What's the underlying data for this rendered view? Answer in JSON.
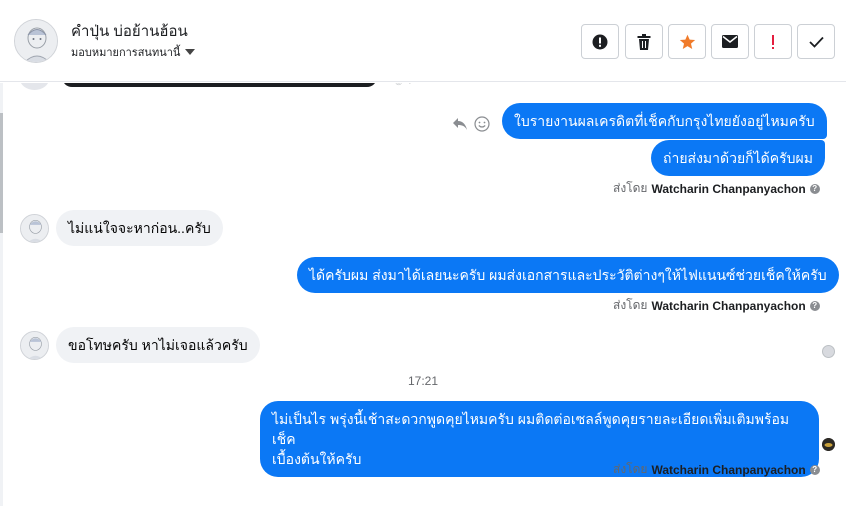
{
  "header": {
    "contact_name": "คำปุ่น บ่อย้านฮ้อน",
    "assign_label": "มอบหมายการสนทนานี้"
  },
  "toolbar": {
    "buttons": [
      "alert-circle-icon",
      "trash-icon",
      "star-icon",
      "mail-icon",
      "exclamation-icon",
      "check-icon"
    ]
  },
  "messages": {
    "m1": "ใบรายงานผลเครดิตที่เช็คกับกรุงไทยยังอยู่ไหมครับ",
    "m2": "ถ่ายส่งมาด้วยก็ได้ครับผม",
    "m3": "ไม่แน่ใจจะหาก่อน..ครับ",
    "m4": "ได้ครับผม ส่งมาได้เลยนะครับ ผมส่งเอกสารและประวัติต่างๆให้ไฟแนนซ์ช่วยเช็คให้ครับ",
    "m5": "ขอโทษครับ หาไม่เจอแล้วครับ",
    "m6_line1": "ไม่เป็นไร พรุ่งนี้เช้าสะดวกพูดคุยไหมครับ ผมติดต่อเซลล์พูดคุยรายละเอียดเพิ่มเติมพร้อมเช็ค",
    "m6_line2": "เบื้องต้นให้ครับ"
  },
  "sent_by": {
    "prefix": "ส่งโดย",
    "name": "Watcharin Chanpanyachon"
  },
  "timestamp": "17:21",
  "colors": {
    "outgoing_bubble": "#0b78f5",
    "incoming_bubble": "#f0f2f5",
    "star": "#f07b2a",
    "exclamation": "#e41e3f"
  }
}
